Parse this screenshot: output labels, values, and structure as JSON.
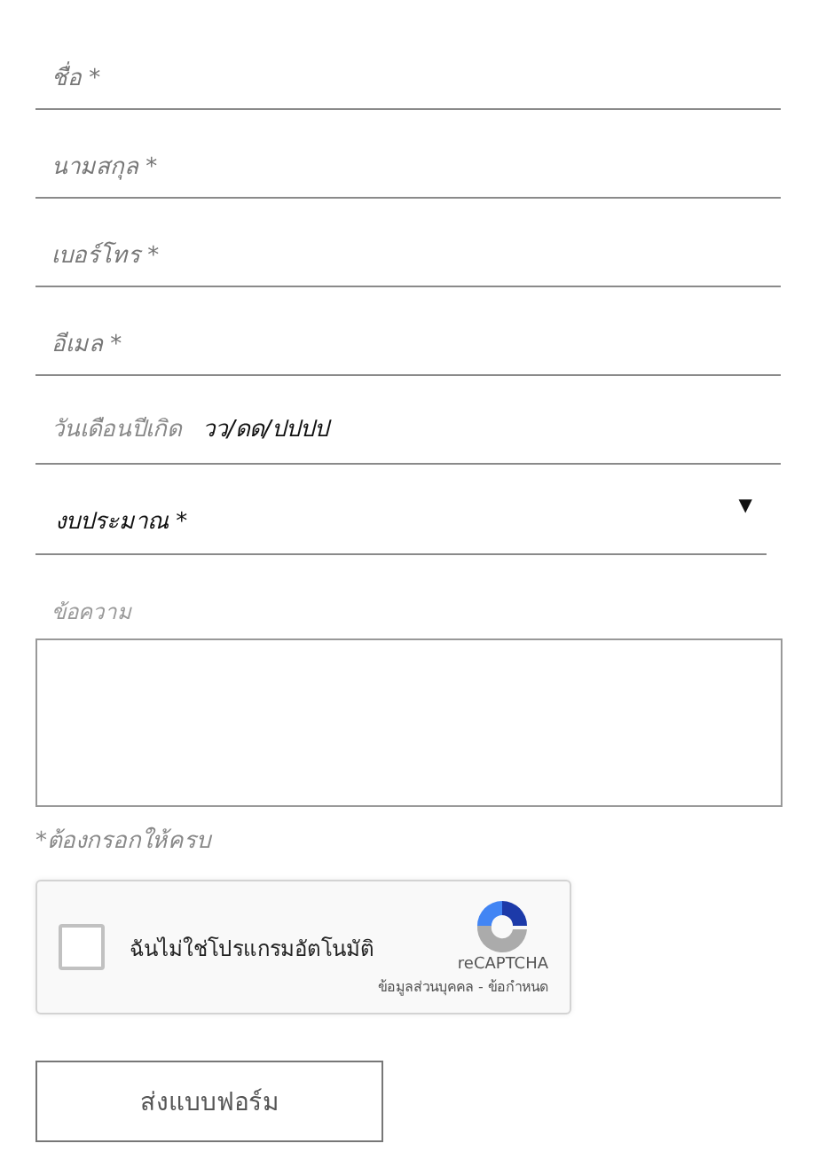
{
  "fields": [
    {
      "kind": "text",
      "placeholder": "ชื่อ *"
    },
    {
      "kind": "text",
      "placeholder": "นามสกุล *"
    },
    {
      "kind": "text",
      "placeholder": "เบอร์โทร *"
    },
    {
      "kind": "text",
      "placeholder": "อีเมล *"
    },
    {
      "kind": "date",
      "label": "วันเดือนปีเกิด",
      "value": "วว/ดด/ปปปป"
    },
    {
      "kind": "select",
      "value": "งบประมาณ *",
      "arrow": "▼"
    }
  ],
  "message": {
    "label": "ข้อความ"
  },
  "required_note": "*ต้องกรอกให้ครบ",
  "captcha": {
    "label": "ฉันไม่ใช่โปรแกรมอัตโนมัติ",
    "checked": false,
    "brand": "reCAPTCHA",
    "footer": "ข้อมูลส่วนบุคคล - ข้อกำหนด"
  },
  "submit": "ส่งแบบฟอร์ม"
}
